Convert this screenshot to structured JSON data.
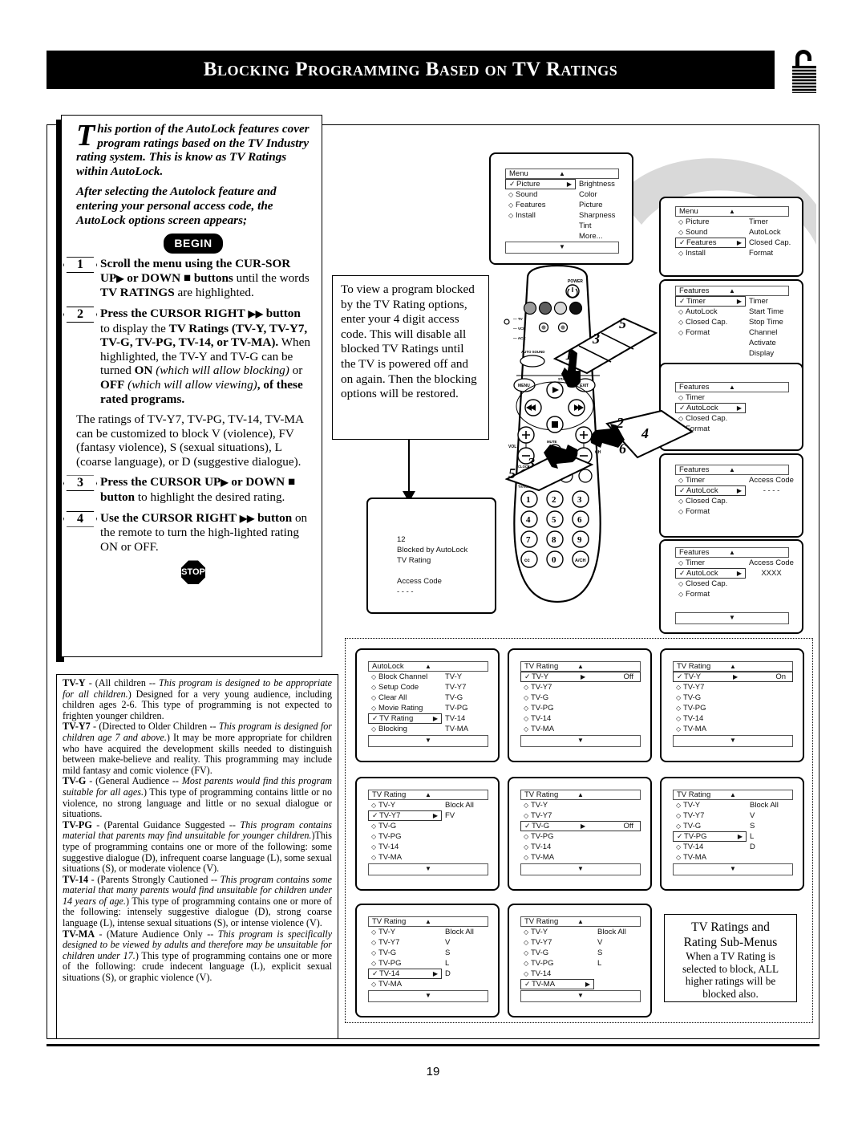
{
  "header": {
    "title": "Blocking Programming Based on TV Ratings",
    "lock_icon": "padlock-icon"
  },
  "page_number": "19",
  "intro": {
    "dropcap": "T",
    "paragraph1": "his portion of the AutoLock features cover program ratings based on the TV Industry rating system. This is know as TV Ratings within AutoLock.",
    "paragraph2": "After selecting the Autolock feature and entering your personal access code, the AutoLock options screen appears;",
    "begin_label": "BEGIN",
    "stop_label": "STOP"
  },
  "steps": [
    {
      "number": "1",
      "bold_lead": "Scroll the menu using the CUR-SOR UP",
      "mid": "or DOWN",
      "bold_tail": "buttons",
      "rest_pre": "until the words ",
      "rest_bold": "TV RATINGS",
      "rest_post": " are highlighted."
    },
    {
      "number": "2",
      "line1_bold": "Press the CURSOR RIGHT",
      "line2_bold": "button",
      "line2_rest": " to display the ",
      "line2_bold2": "TV Ratings (TV-Y, TV-Y7, TV-G, TV-PG, TV-14, or TV-MA).",
      "line3": " When highlighted, the TV-Y and TV-G can be turned ",
      "on_bold": "ON",
      "on_ital": "(which will allow blocking)",
      "or_txt": " or ",
      "off_bold": "OFF",
      "off_ital": "(which will allow viewing)",
      "tail": ", of these rated programs."
    },
    {
      "number": "3",
      "bold_lead": "Press the CURSOR UP",
      "mid": "or DOWN",
      "bold_tail": "button",
      "rest": " to highlight the desired rating."
    },
    {
      "number": "4",
      "bold_lead": "Use the CURSOR RIGHT",
      "bold_tail": "button",
      "rest": " on the remote to turn the high-lighted rating ON or OFF."
    }
  ],
  "paragraph_ratings_custom": "The ratings of TV-Y7, TV-PG, TV-14, TV-MA can be customized to block V (violence), FV (fantasy violence), S (sexual situations), L (coarse language), or D (suggestive dialogue).",
  "note_box": {
    "text": "To view a program blocked by the TV Rating options, enter your 4 digit access code. This will disable all blocked TV Ratings until the TV is powered off and on again. Then the blocking options will be restored."
  },
  "blocked_screen": {
    "channel": "12",
    "line1": "Blocked by AutoLock",
    "line2": "TV Rating",
    "line3": "Access Code",
    "line4": "- - - -"
  },
  "menus": {
    "picture_menu": {
      "title": "Menu",
      "up": "▲",
      "down": "▼",
      "items": [
        {
          "label": "Picture",
          "marker": "check",
          "arrow": true
        },
        {
          "label": "Sound",
          "marker": "dot"
        },
        {
          "label": "Features",
          "marker": "dot"
        },
        {
          "label": "Install",
          "marker": "dot"
        }
      ],
      "submenu": [
        "Brightness",
        "Color",
        "Picture",
        "Sharpness",
        "Tint",
        "More..."
      ]
    },
    "features_menu": {
      "title": "Menu",
      "up": "▲",
      "items": [
        {
          "label": "Picture",
          "marker": "dot"
        },
        {
          "label": "Sound",
          "marker": "dot"
        },
        {
          "label": "Features",
          "marker": "check",
          "arrow": true
        },
        {
          "label": "Install",
          "marker": "dot"
        }
      ],
      "submenu": [
        "Timer",
        "AutoLock",
        "Closed Cap.",
        "Format"
      ]
    },
    "timer_menu": {
      "title": "Features",
      "up": "▲",
      "items": [
        {
          "label": "Timer",
          "marker": "check",
          "arrow": true
        },
        {
          "label": "AutoLock",
          "marker": "dot"
        },
        {
          "label": "Closed Cap.",
          "marker": "dot"
        },
        {
          "label": "Format",
          "marker": "dot"
        }
      ],
      "submenu": [
        "Timer",
        "Start Time",
        "Stop Time",
        "Channel",
        "Activate",
        "Display"
      ]
    },
    "autolock_sel_menu": {
      "title": "Features",
      "up": "▲",
      "items": [
        {
          "label": "Timer",
          "marker": "dot"
        },
        {
          "label": "AutoLock",
          "marker": "check",
          "arrow": true
        },
        {
          "label": "Closed Cap.",
          "marker": "dot"
        },
        {
          "label": "Format",
          "marker": "dot"
        }
      ],
      "submenu": []
    },
    "access_code_empty": {
      "title": "Features",
      "up": "▲",
      "items": [
        {
          "label": "Timer",
          "marker": "dot"
        },
        {
          "label": "AutoLock",
          "marker": "check",
          "arrow": true
        },
        {
          "label": "Closed Cap.",
          "marker": "dot"
        },
        {
          "label": "Format",
          "marker": "dot"
        }
      ],
      "submenu": [
        "Access Code",
        "- - - -"
      ]
    },
    "access_code_filled": {
      "title": "Features",
      "up": "▲",
      "down": "▼",
      "items": [
        {
          "label": "Timer",
          "marker": "dot"
        },
        {
          "label": "AutoLock",
          "marker": "check",
          "arrow": true
        },
        {
          "label": "Closed Cap.",
          "marker": "dot"
        },
        {
          "label": "Format",
          "marker": "dot"
        }
      ],
      "submenu": [
        "Access Code",
        "XXXX"
      ]
    },
    "autolock_menu": {
      "title": "AutoLock",
      "up": "▲",
      "down": "▼",
      "items": [
        {
          "label": "Block Channel",
          "marker": "dot"
        },
        {
          "label": "Setup Code",
          "marker": "dot"
        },
        {
          "label": "Clear All",
          "marker": "dot"
        },
        {
          "label": "Movie Rating",
          "marker": "dot"
        },
        {
          "label": "TV Rating",
          "marker": "check",
          "arrow": true
        },
        {
          "label": "Blocking",
          "marker": "dot"
        }
      ],
      "submenu": [
        "TV-Y",
        "TV-Y7",
        "TV-G",
        "TV-PG",
        "TV-14",
        "TV-MA"
      ]
    },
    "tvy_off": {
      "title": "TV Rating",
      "up": "▲",
      "down": "▼",
      "items": [
        {
          "label": "TV-Y",
          "marker": "check",
          "arrow": true,
          "value": "Off"
        },
        {
          "label": "TV-Y7",
          "marker": "dot"
        },
        {
          "label": "TV-G",
          "marker": "dot"
        },
        {
          "label": "TV-PG",
          "marker": "dot"
        },
        {
          "label": "TV-14",
          "marker": "dot"
        },
        {
          "label": "TV-MA",
          "marker": "dot"
        }
      ]
    },
    "tvy_on": {
      "title": "TV Rating",
      "up": "▲",
      "down": "▼",
      "items": [
        {
          "label": "TV-Y",
          "marker": "check",
          "arrow": true,
          "value": "On"
        },
        {
          "label": "TV-Y7",
          "marker": "dot"
        },
        {
          "label": "TV-G",
          "marker": "dot"
        },
        {
          "label": "TV-PG",
          "marker": "dot"
        },
        {
          "label": "TV-14",
          "marker": "dot"
        },
        {
          "label": "TV-MA",
          "marker": "dot"
        }
      ]
    },
    "tvy7": {
      "title": "TV Rating",
      "up": "▲",
      "down": "▼",
      "items": [
        {
          "label": "TV-Y",
          "marker": "dot"
        },
        {
          "label": "TV-Y7",
          "marker": "check",
          "arrow": true
        },
        {
          "label": "TV-G",
          "marker": "dot"
        },
        {
          "label": "TV-PG",
          "marker": "dot"
        },
        {
          "label": "TV-14",
          "marker": "dot"
        },
        {
          "label": "TV-MA",
          "marker": "dot"
        }
      ],
      "submenu": [
        "Block All",
        "FV"
      ]
    },
    "tvg": {
      "title": "TV Rating",
      "up": "▲",
      "down": "▼",
      "items": [
        {
          "label": "TV-Y",
          "marker": "dot"
        },
        {
          "label": "TV-Y7",
          "marker": "dot"
        },
        {
          "label": "TV-G",
          "marker": "check",
          "arrow": true,
          "value": "Off"
        },
        {
          "label": "TV-PG",
          "marker": "dot"
        },
        {
          "label": "TV-14",
          "marker": "dot"
        },
        {
          "label": "TV-MA",
          "marker": "dot"
        }
      ]
    },
    "tvpg": {
      "title": "TV Rating",
      "up": "▲",
      "down": "▼",
      "items": [
        {
          "label": "TV-Y",
          "marker": "dot"
        },
        {
          "label": "TV-Y7",
          "marker": "dot"
        },
        {
          "label": "TV-G",
          "marker": "dot"
        },
        {
          "label": "TV-PG",
          "marker": "check",
          "arrow": true
        },
        {
          "label": "TV-14",
          "marker": "dot"
        },
        {
          "label": "TV-MA",
          "marker": "dot"
        }
      ],
      "submenu": [
        "Block All",
        "V",
        "S",
        "L",
        "D"
      ]
    },
    "tv14": {
      "title": "TV Rating",
      "up": "▲",
      "down": "▼",
      "items": [
        {
          "label": "TV-Y",
          "marker": "dot"
        },
        {
          "label": "TV-Y7",
          "marker": "dot"
        },
        {
          "label": "TV-G",
          "marker": "dot"
        },
        {
          "label": "TV-PG",
          "marker": "dot"
        },
        {
          "label": "TV-14",
          "marker": "check",
          "arrow": true
        },
        {
          "label": "TV-MA",
          "marker": "dot"
        }
      ],
      "submenu": [
        "Block All",
        "V",
        "S",
        "L",
        "D"
      ]
    },
    "tvma": {
      "title": "TV Rating",
      "up": "▲",
      "down": "▼",
      "items": [
        {
          "label": "TV-Y",
          "marker": "dot"
        },
        {
          "label": "TV-Y7",
          "marker": "dot"
        },
        {
          "label": "TV-G",
          "marker": "dot"
        },
        {
          "label": "TV-PG",
          "marker": "dot"
        },
        {
          "label": "TV-14",
          "marker": "dot"
        },
        {
          "label": "TV-MA",
          "marker": "check",
          "arrow": true
        }
      ],
      "submenu": [
        "Block All",
        "V",
        "S",
        "L"
      ]
    }
  },
  "caption": {
    "title_line1": "TV Ratings and",
    "title_line2": "Rating Sub-Menus",
    "body": "When a TV Rating is selected to block, ALL higher ratings will be blocked also."
  },
  "rating_descriptions": [
    {
      "code": "TV-Y",
      "dash": " - ",
      "paren_open": "(All children -- ",
      "italic": "This program is designed to be appropriate for all children.",
      "rest": ") Designed for a very young audience, including children ages 2-6. This type of programming is not expected to frighten younger children."
    },
    {
      "code": "TV-Y7",
      "dash": " - ",
      "paren_open": "(Directed to Older Children -- ",
      "italic": "This program is designed for children age 7 and above.",
      "rest": ") It may be more appropriate for children who have acquired the development skills needed to distinguish between make-believe and reality. This programming may include mild fantasy and comic violence (FV)."
    },
    {
      "code": "TV-G",
      "dash": " - ",
      "paren_open": "(General Audience -- ",
      "italic": "Most parents would find this program suitable for all ages.",
      "rest": ") This type of programming contains little or no violence, no strong language and little or no sexual dialogue or situations."
    },
    {
      "code": "TV-PG",
      "dash": " - ",
      "paren_open": "(Parental Guidance Suggested -- ",
      "italic": "This program contains material that parents may find unsuitable for younger children.",
      "rest": ")This type of programming contains one or more of the following: some suggestive dialogue (D), infrequent coarse language (L), some sexual situations (S), or moderate violence (V)."
    },
    {
      "code": "TV-14",
      "dash": " - ",
      "paren_open": "(Parents Strongly Cautioned -- ",
      "italic": "This program contains some material that many parents would find unsuitable for children under 14 years of age.",
      "rest": ") This type of programming contains one or more of the following: intensely suggestive dialogue (D), strong coarse language (L), intense sexual situations (S), or intense violence (V)."
    },
    {
      "code": "TV-MA",
      "dash": " - ",
      "paren_open": "(Mature Audience Only -- ",
      "italic": "This program is specifically designed to be viewed by adults and therefore may be unsuitable for children under 17.",
      "rest": ") This type of programming contains one or more of the following: crude indecent language (L), explicit sexual situations (S), or graphic violence (V)."
    }
  ],
  "remote": {
    "power_label": "POWER",
    "source_labels": [
      "TV",
      "VCR",
      "ACC"
    ],
    "auto_sound": "AUTO SOUND",
    "picture_label": "PICTURE",
    "status_label": "STATUS",
    "menu_label": "MENU",
    "exit_label": "EXIT",
    "mute_label": "MUTE",
    "ch_label": "CH",
    "vol_label": "VOL",
    "clock_label": "CLOCK",
    "sleep_label": "SLEEP",
    "tv_vcr_label": "TV/VCR",
    "keys": [
      "1",
      "2",
      "3",
      "4",
      "5",
      "6",
      "7",
      "8",
      "9",
      "cc",
      "0",
      "A/CH"
    ],
    "callouts_top": [
      "1",
      "3",
      "5"
    ],
    "callouts_right": [
      "2",
      "4",
      "6"
    ],
    "callouts_bottom": [
      "5",
      "3",
      "1"
    ]
  }
}
